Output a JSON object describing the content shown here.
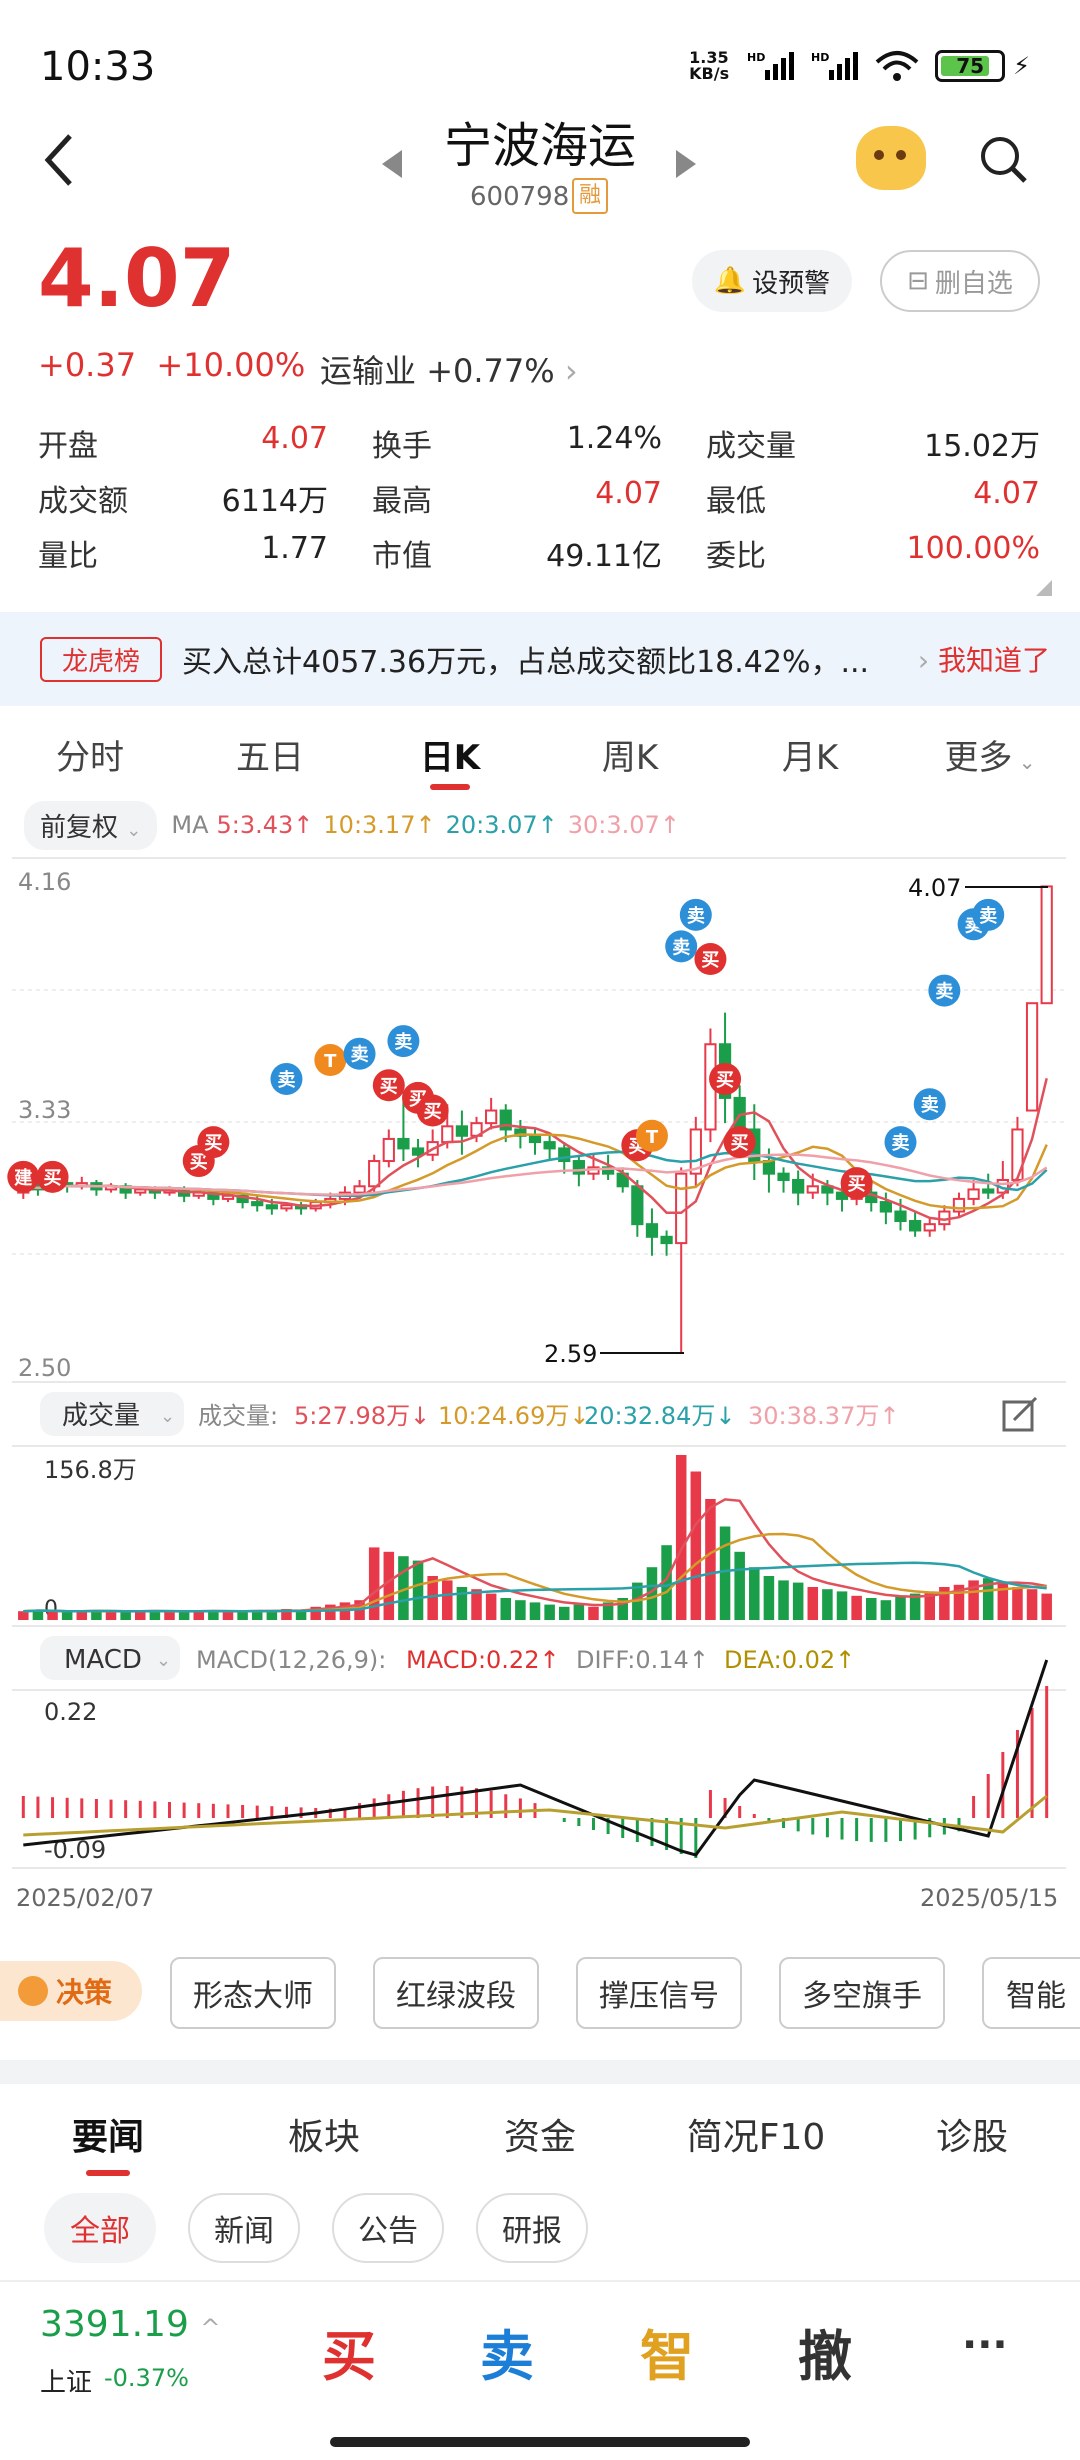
{
  "status": {
    "time": "10:33",
    "speed": "1.35 KB/s",
    "battery": "75"
  },
  "header": {
    "name": "宁波海运",
    "code": "600798",
    "rong": "融"
  },
  "quote": {
    "price": "4.07",
    "change": "+0.37",
    "change_pct": "+10.00%",
    "industry": "运输业",
    "industry_pct": "+0.77%",
    "alert": "设预警",
    "remove": "删自选"
  },
  "stats": [
    [
      {
        "label": "开盘",
        "value": "4.07",
        "color": "red"
      },
      {
        "label": "换手",
        "value": "1.24%"
      },
      {
        "label": "成交量",
        "value": "15.02万"
      }
    ],
    [
      {
        "label": "成交额",
        "value": "6114万"
      },
      {
        "label": "最高",
        "value": "4.07",
        "color": "red"
      },
      {
        "label": "最低",
        "value": "4.07",
        "color": "red"
      }
    ],
    [
      {
        "label": "量比",
        "value": "1.77"
      },
      {
        "label": "市值",
        "value": "49.11亿"
      },
      {
        "label": "委比",
        "value": "100.00%",
        "color": "red"
      }
    ]
  ],
  "lhb": {
    "tag": "龙虎榜",
    "text": "买入总计4057.36万元，占总成交额比18.42%，...",
    "ok": "我知道了"
  },
  "tabs": [
    "分时",
    "五日",
    "日K",
    "周K",
    "月K",
    "更多"
  ],
  "active_tab": "日K",
  "ma": {
    "selector": "前复权",
    "label": "MA",
    "ma5": "5:3.43↑",
    "ma10": "10:3.17↑",
    "ma20": "20:3.07↑",
    "ma30": "30:3.07↑",
    "colors": {
      "ma5": "#e0515b",
      "ma10": "#d49a2a",
      "ma20": "#2aa0a8",
      "ma30": "#f0a0a8"
    }
  },
  "kline": {
    "top_price": "4.16",
    "mid_price": "3.33",
    "bottom_price": "2.50",
    "max_label": "4.07",
    "min_label": "2.59"
  },
  "volume": {
    "selector": "成交量",
    "label": "成交量:",
    "v5": "5:27.98万↓",
    "v10": "10:24.69万↓",
    "v20": "20:32.84万↓",
    "v30": "30:38.37万↑",
    "max": "156.8万",
    "zero": "0"
  },
  "macd": {
    "selector": "MACD",
    "params": "MACD(12,26,9):",
    "macd": "MACD:0.22↑",
    "diff": "DIFF:0.14↑",
    "dea": "DEA:0.02↑",
    "top": "0.22",
    "bottom": "-0.09",
    "date_start": "2025/02/07",
    "date_end": "2025/05/15"
  },
  "signals": {
    "jian": "建",
    "buy": "买",
    "sell": "卖",
    "t": "T"
  },
  "decision": {
    "main": "决策",
    "buttons": [
      "形态大师",
      "红绿波段",
      "撑压信号",
      "多空旗手",
      "智能"
    ]
  },
  "news_tabs": [
    "要闻",
    "板块",
    "资金",
    "简况F10",
    "诊股"
  ],
  "filters": [
    "全部",
    "新闻",
    "公告",
    "研报"
  ],
  "bottom": {
    "index_value": "3391.19",
    "index_name": "上证",
    "index_change": "-0.37%",
    "buy": "买",
    "sell": "卖",
    "smart": "智",
    "cancel": "撤",
    "more": "···"
  }
}
